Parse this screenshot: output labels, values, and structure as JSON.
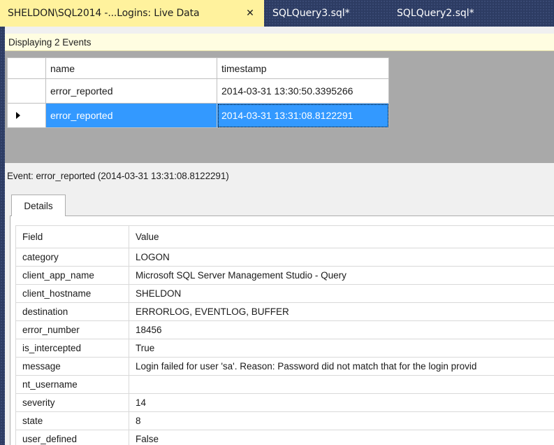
{
  "tabs": [
    {
      "label": "SHELDON\\SQL2014 -...Logins: Live Data",
      "active": true,
      "close_glyph": "✕"
    },
    {
      "label": "SQLQuery3.sql*",
      "active": false
    },
    {
      "label": "SQLQuery2.sql*",
      "active": false
    }
  ],
  "status": {
    "text": "Displaying 2 Events"
  },
  "events_grid": {
    "columns": [
      "name",
      "timestamp"
    ],
    "rows": [
      {
        "name": "error_reported",
        "timestamp": "2014-03-31 13:30:50.3395266",
        "selected": false
      },
      {
        "name": "error_reported",
        "timestamp": "2014-03-31 13:31:08.8122291",
        "selected": true
      }
    ]
  },
  "event_title": "Event: error_reported (2014-03-31 13:31:08.8122291)",
  "details_tab": {
    "label": "Details"
  },
  "details": {
    "columns": [
      "Field",
      "Value"
    ],
    "rows": [
      {
        "field": "category",
        "value": "LOGON"
      },
      {
        "field": "client_app_name",
        "value": "Microsoft SQL Server Management Studio - Query"
      },
      {
        "field": "client_hostname",
        "value": "SHELDON"
      },
      {
        "field": "destination",
        "value": "ERRORLOG, EVENTLOG, BUFFER"
      },
      {
        "field": "error_number",
        "value": "18456"
      },
      {
        "field": "is_intercepted",
        "value": "True"
      },
      {
        "field": "message",
        "value": "Login failed for user 'sa'. Reason: Password did not match that for the login provid"
      },
      {
        "field": "nt_username",
        "value": ""
      },
      {
        "field": "severity",
        "value": "14"
      },
      {
        "field": "state",
        "value": "8"
      },
      {
        "field": "user_defined",
        "value": "False"
      }
    ]
  },
  "colors": {
    "active_tab": "#fff29d",
    "selection": "#3399ff",
    "status_bar": "#fffde1",
    "background": "#2d3c63"
  }
}
